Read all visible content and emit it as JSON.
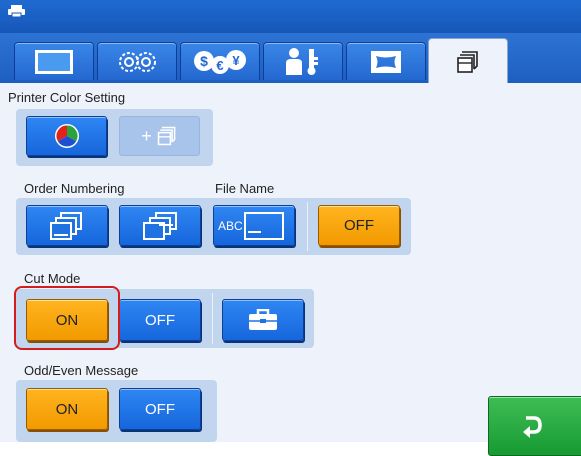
{
  "header": {
    "icon": "printer-icon"
  },
  "tabs": [
    {
      "name": "display-icon",
      "active": false
    },
    {
      "name": "gears-icon",
      "active": false
    },
    {
      "name": "currency-icon",
      "active": false
    },
    {
      "name": "user-key-icon",
      "active": false
    },
    {
      "name": "frame-icon",
      "active": false
    },
    {
      "name": "paper-stack-icon",
      "active": true
    }
  ],
  "printer_color": {
    "label": "Printer Color Setting",
    "color_icon": "color-wheel-icon",
    "add_icon": "add-paper-icon",
    "add_label": "+"
  },
  "order_numbering": {
    "label": "Order Numbering",
    "btn1_icon": "stacked-sheets-icon",
    "btn2_icon": "stacked-sheets-offset-icon"
  },
  "file_name": {
    "label": "File Name",
    "abc_label": "ABC",
    "off_label": "OFF"
  },
  "cut_mode": {
    "label": "Cut Mode",
    "on_label": "ON",
    "off_label": "OFF",
    "toolbox_icon": "toolbox-icon"
  },
  "odd_even": {
    "label": "Odd/Even Message",
    "on_label": "ON",
    "off_label": "OFF"
  },
  "footer": {
    "return_icon": "return-arrow-icon"
  },
  "colors": {
    "accent_blue": "#1666dc",
    "selected_orange": "#f29a00",
    "highlight_red": "#d41c1c",
    "go_green": "#179a32"
  }
}
